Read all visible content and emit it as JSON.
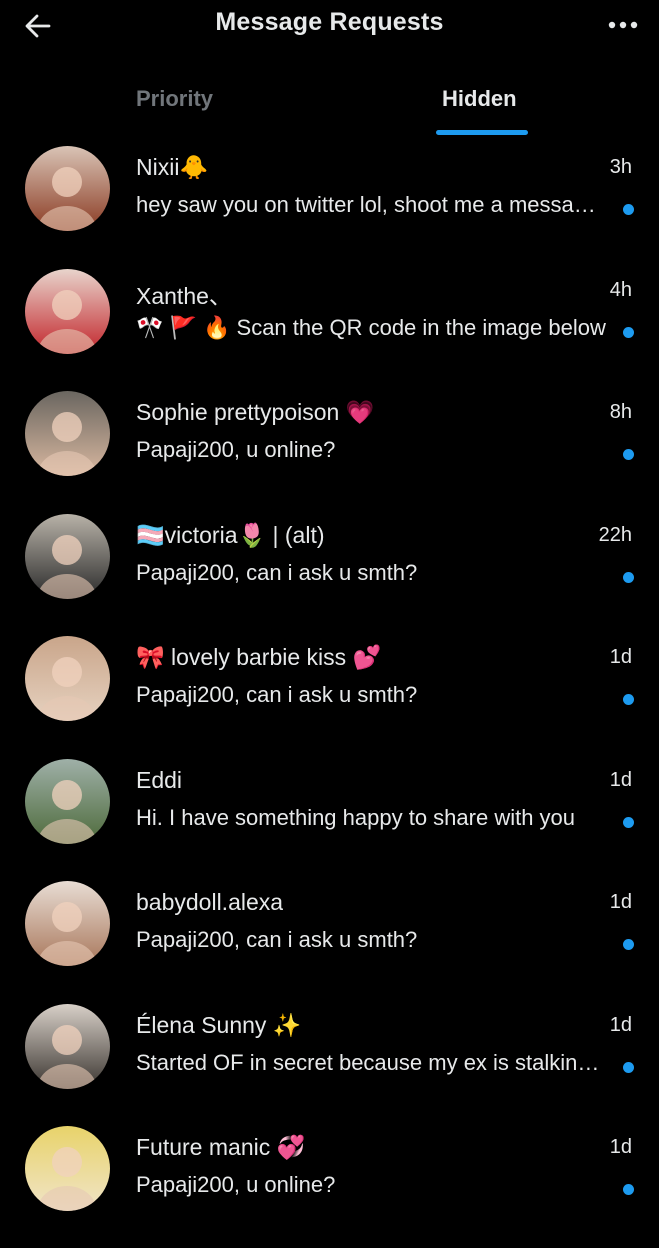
{
  "header": {
    "title": "Message Requests",
    "back_icon": "arrow-left-icon",
    "more_icon": "more-horizontal-icon"
  },
  "tabs": [
    {
      "label": "Priority",
      "active": false
    },
    {
      "label": "Hidden",
      "active": true
    }
  ],
  "colors": {
    "background": "#000000",
    "text": "#e7e9ea",
    "muted": "#71767b",
    "accent": "#1d9bf0"
  },
  "conversations": [
    {
      "name": "Nixii🐥",
      "time": "3h",
      "preview": "hey saw you on twitter lol, shoot me a message…",
      "unread": true,
      "avatar_colors": [
        "#d9c4b6",
        "#8a3a22"
      ]
    },
    {
      "name": "Xanthe、",
      "time": "4h",
      "preview": "🎌 🚩 🔥 Scan the QR code in the image below",
      "unread": true,
      "avatar_colors": [
        "#e8d4cc",
        "#c2242a"
      ]
    },
    {
      "name": "Sophie prettypoison 💗",
      "time": "8h",
      "preview": "Papaji200, u online?",
      "unread": true,
      "avatar_colors": [
        "#6a6660",
        "#d9b8a0"
      ]
    },
    {
      "name": "🏳️‍⚧️victoria🌷 | (alt)",
      "time": "22h",
      "preview": "Papaji200, can i ask u smth?",
      "unread": true,
      "avatar_colors": [
        "#b8b2a8",
        "#2a2a2a"
      ]
    },
    {
      "name": "🎀 lovely barbie kiss 💕",
      "time": "1d",
      "preview": "Papaji200, can i ask u smth?",
      "unread": true,
      "avatar_colors": [
        "#c9a58a",
        "#e6d2c0"
      ]
    },
    {
      "name": "Eddi",
      "time": "1d",
      "preview": "Hi. I have something happy to share with you",
      "unread": true,
      "avatar_colors": [
        "#9fb0a8",
        "#4d6a3a"
      ]
    },
    {
      "name": "babydoll.alexa",
      "time": "1d",
      "preview": "Papaji200, can i ask u smth?",
      "unread": true,
      "avatar_colors": [
        "#e8ddd4",
        "#a8765a"
      ]
    },
    {
      "name": "Élena Sunny ✨",
      "time": "1d",
      "preview": "Started OF in secret because my ex is stalking me",
      "unread": true,
      "avatar_colors": [
        "#d8d0c8",
        "#3a3530"
      ]
    },
    {
      "name": "Future manic 💞",
      "time": "1d",
      "preview": "Papaji200, u online?",
      "unread": true,
      "avatar_colors": [
        "#e8d36a",
        "#f0e4c8"
      ]
    }
  ]
}
